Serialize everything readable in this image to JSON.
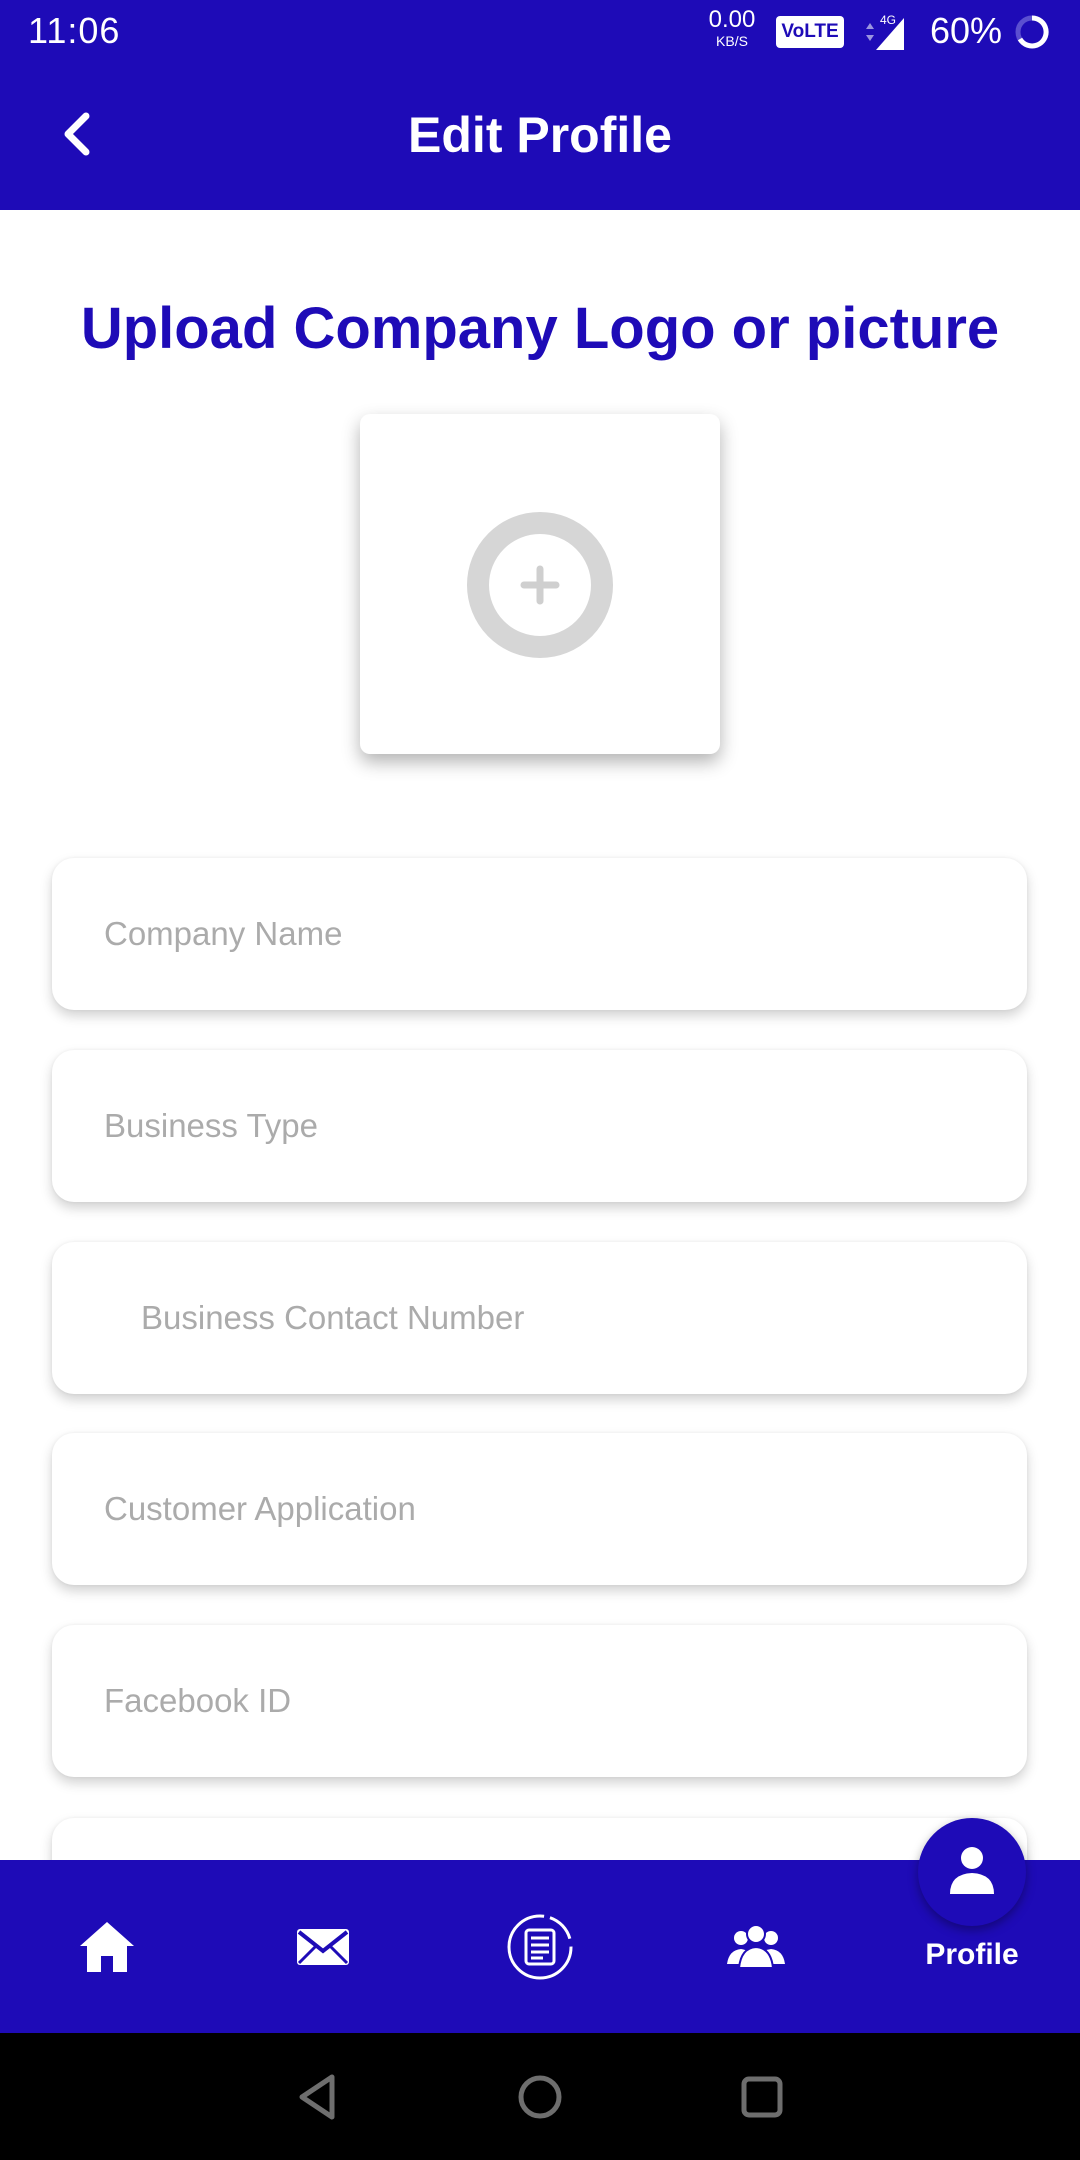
{
  "status_bar": {
    "time": "11:06",
    "net_speed_value": "0.00",
    "net_speed_unit": "KB/S",
    "volte": "VoLTE",
    "network": "4G",
    "battery": "60%"
  },
  "header": {
    "title": "Edit Profile",
    "back_icon": "chevron-left-icon"
  },
  "upload": {
    "title": "Upload Company Logo or picture",
    "icon": "add-circle-icon"
  },
  "form": {
    "fields": [
      {
        "placeholder": "Company Name",
        "value": ""
      },
      {
        "placeholder": "Business Type",
        "value": ""
      },
      {
        "placeholder": "Business Contact Number",
        "value": ""
      },
      {
        "placeholder": "Customer Application",
        "value": ""
      },
      {
        "placeholder": "Facebook ID",
        "value": ""
      }
    ]
  },
  "bottom_nav": {
    "items": [
      {
        "icon": "home-icon"
      },
      {
        "icon": "mail-icon"
      },
      {
        "icon": "list-icon"
      },
      {
        "icon": "group-icon"
      },
      {
        "icon": "person-icon",
        "label": "Profile",
        "active": true
      }
    ]
  },
  "colors": {
    "primary": "#1e0bb7",
    "placeholder": "#ababab",
    "icon_grey": "#d6d6d6"
  }
}
